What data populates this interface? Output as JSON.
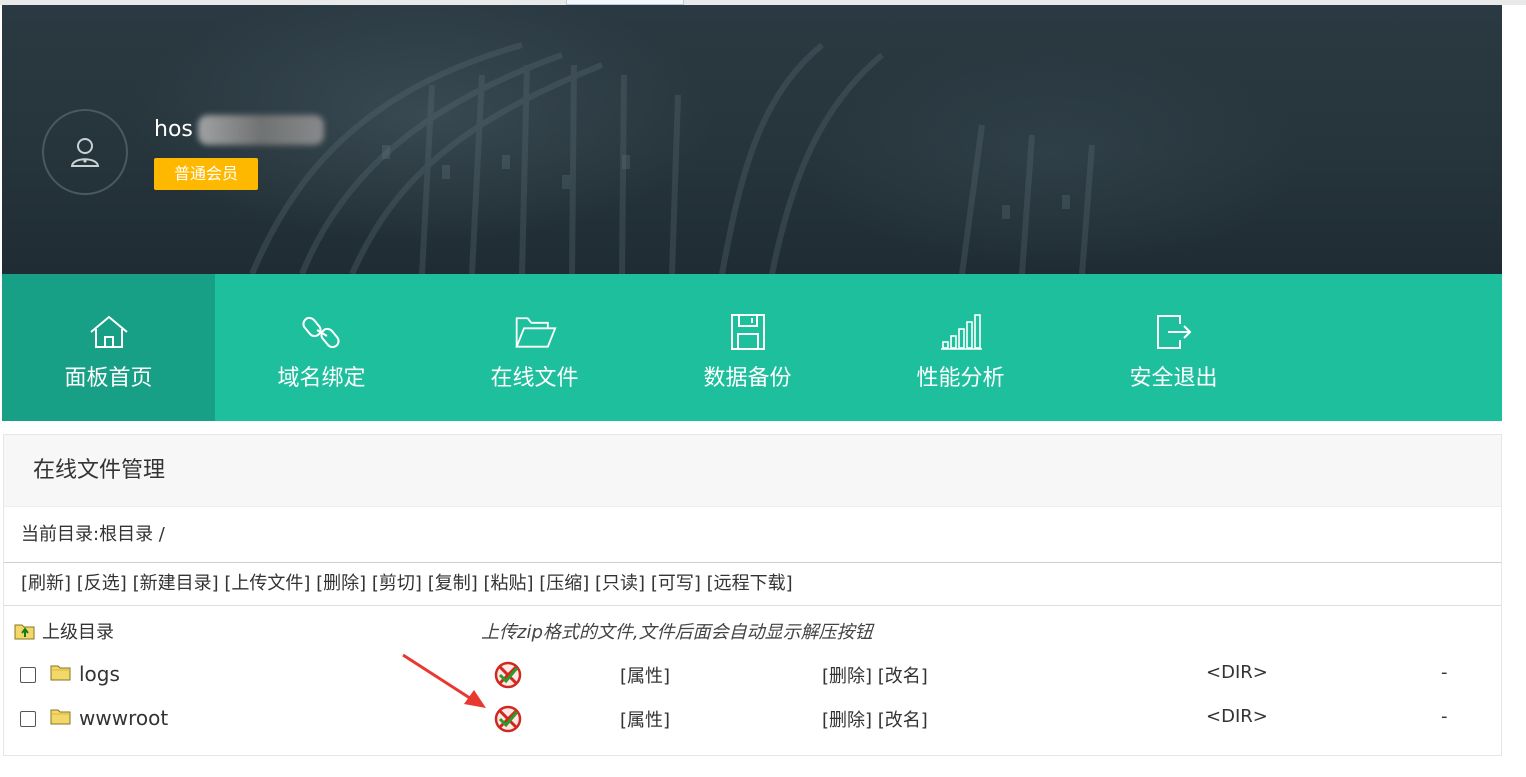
{
  "header": {
    "username": "hos",
    "member_level": "普通会员"
  },
  "nav": {
    "items": [
      {
        "label": "面板首页",
        "icon": "home-icon"
      },
      {
        "label": "域名绑定",
        "icon": "link-icon"
      },
      {
        "label": "在线文件",
        "icon": "folder-open-icon"
      },
      {
        "label": "数据备份",
        "icon": "save-icon"
      },
      {
        "label": "性能分析",
        "icon": "bar-chart-icon"
      },
      {
        "label": "安全退出",
        "icon": "logout-icon"
      }
    ]
  },
  "file_manager": {
    "title": "在线文件管理",
    "current_dir_label": "当前目录:",
    "current_dir": "根目录 /",
    "toolbar": [
      "[刷新]",
      "[反选]",
      "[新建目录]",
      "[上传文件]",
      "[删除]",
      "[剪切]",
      "[复制]",
      "[粘贴]",
      "[压缩]",
      "[只读]",
      "[可写]",
      "[远程下载]"
    ],
    "parent_dir": "上级目录",
    "hint": "上传zip格式的文件,文件后面会自动显示解压按钮",
    "files": [
      {
        "name": "logs",
        "attr": "[属性]",
        "delete": "[删除]",
        "rename": "[改名]",
        "type": "<DIR>",
        "size": "-"
      },
      {
        "name": "wwwroot",
        "attr": "[属性]",
        "delete": "[删除]",
        "rename": "[改名]",
        "type": "<DIR>",
        "size": "-"
      }
    ]
  },
  "colors": {
    "nav_bg": "#1ebf9d",
    "nav_active": "#17a085",
    "badge": "#ffb800",
    "annotation_arrow": "#e8382f"
  }
}
